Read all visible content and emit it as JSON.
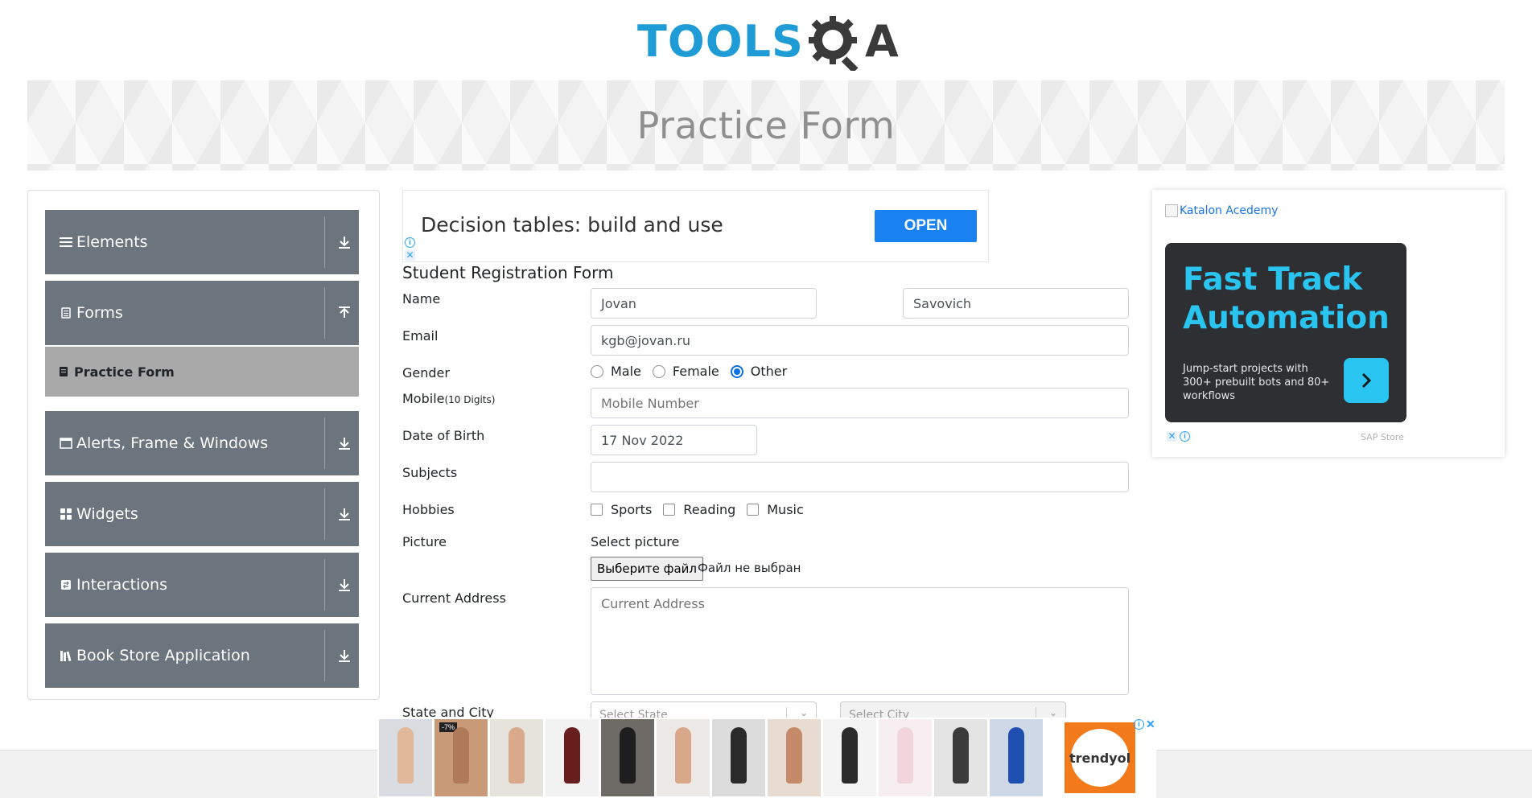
{
  "header": {
    "logo_part1": "TOOLS",
    "logo_part2": "A",
    "logo_alt": "TOOLSQA"
  },
  "banner": {
    "title": "Practice Form"
  },
  "sidebar": {
    "groups": [
      {
        "label": "Elements",
        "icon": "menu-icon",
        "arrow": "download-icon"
      },
      {
        "label": "Forms",
        "icon": "document-icon",
        "arrow": "upload-icon"
      },
      {
        "label": "Alerts, Frame & Windows",
        "icon": "window-icon",
        "arrow": "download-icon"
      },
      {
        "label": "Widgets",
        "icon": "grid-icon",
        "arrow": "download-icon"
      },
      {
        "label": "Interactions",
        "icon": "interaction-icon",
        "arrow": "download-icon"
      },
      {
        "label": "Book Store Application",
        "icon": "books-icon",
        "arrow": "download-icon"
      }
    ],
    "active_item": {
      "label": "Practice Form",
      "icon": "bookmark-icon"
    }
  },
  "top_ad": {
    "text": "Decision tables: build and use",
    "button": "OPEN"
  },
  "form": {
    "title": "Student Registration Form",
    "labels": {
      "name": "Name",
      "email": "Email",
      "gender": "Gender",
      "mobile": "Mobile",
      "mobile_hint": "(10 Digits)",
      "dob": "Date of Birth",
      "subjects": "Subjects",
      "hobbies": "Hobbies",
      "picture": "Picture",
      "address": "Current Address",
      "state_city": "State and City"
    },
    "first_name": "Jovan",
    "last_name": "Savovich",
    "email": "kgb@jovan.ru",
    "gender_options": [
      "Male",
      "Female",
      "Other"
    ],
    "gender_selected": "Other",
    "mobile_placeholder": "Mobile Number",
    "dob": "17 Nov 2022",
    "subjects": "",
    "hobby_options": [
      "Sports",
      "Reading",
      "Music"
    ],
    "picture_label": "Select picture",
    "file_button": "Выберите файл",
    "file_status": "Файл не выбран",
    "address_placeholder": "Current Address",
    "state_placeholder": "Select State",
    "city_placeholder": "Select City"
  },
  "side_ad": {
    "broken_image_alt": "Katalon Acedemy",
    "headline": "Fast Track Automation",
    "body": "Jump-start projects with 300+ prebuilt bots and 80+ workflows",
    "store": "SAP Store"
  },
  "bottom_ad": {
    "discount_tag": "-7%",
    "brand": "trendyol"
  },
  "colors": {
    "sidebar_group": "#6c757d",
    "sidebar_active": "#a9a9a9",
    "accent_blue": "#1a82f0",
    "logo_blue": "#1f9bd6",
    "card_dark": "#2d2f33",
    "card_cyan": "#29c4f0",
    "trendyol_orange": "#f27a1a"
  }
}
